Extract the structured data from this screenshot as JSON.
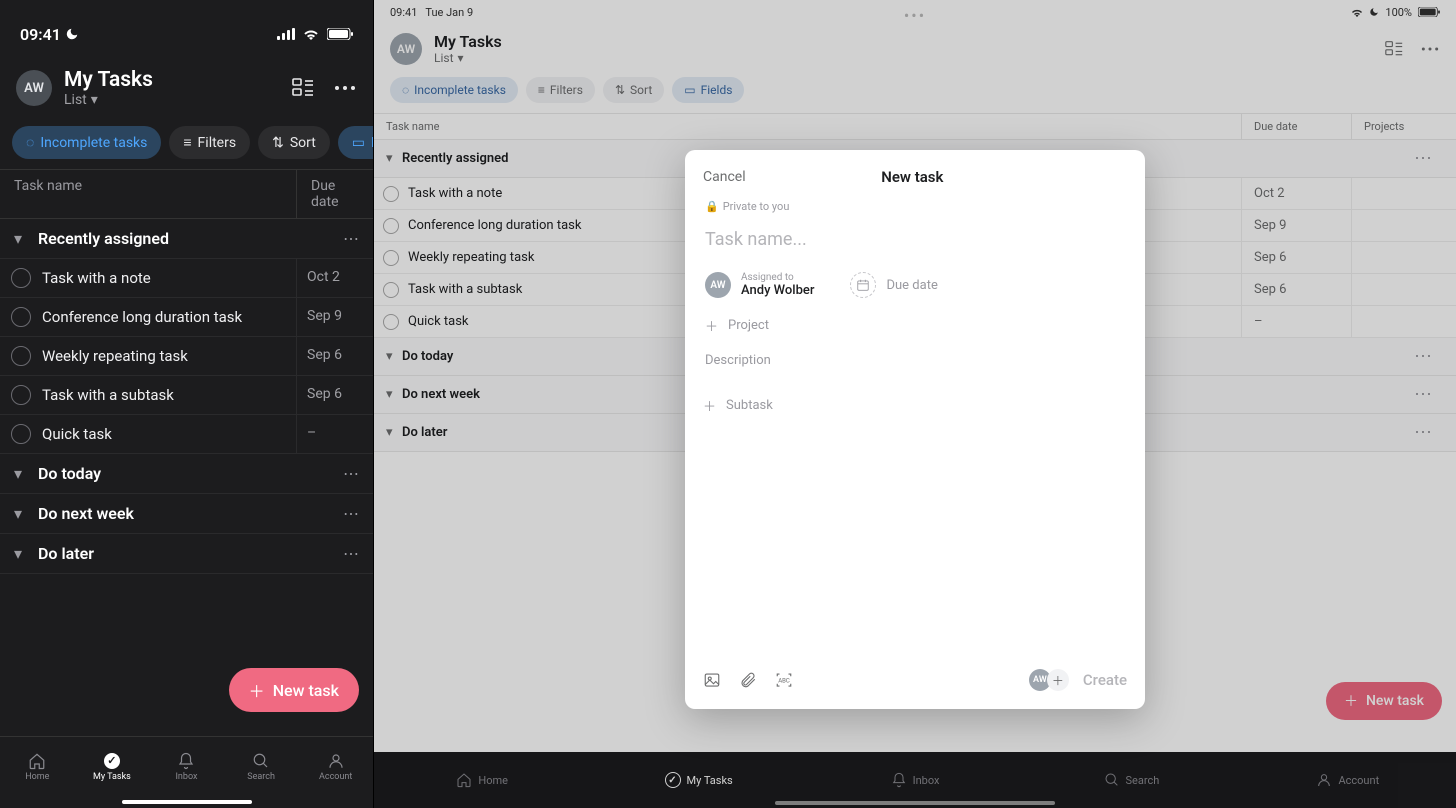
{
  "phone": {
    "status_time": "09:41",
    "avatar": "AW",
    "title": "My Tasks",
    "subtitle": "List",
    "chips": {
      "incomplete": "Incomplete tasks",
      "filters": "Filters",
      "sort": "Sort",
      "fields": "Fields"
    },
    "columns": {
      "task": "Task name",
      "due": "Due date"
    },
    "sections": [
      {
        "title": "Recently assigned",
        "rows": [
          {
            "name": "Task with a note",
            "due": "Oct 2"
          },
          {
            "name": "Conference long duration task",
            "due": "Sep 9"
          },
          {
            "name": "Weekly repeating task",
            "due": "Sep 6"
          },
          {
            "name": "Task with a subtask",
            "due": "Sep 6"
          },
          {
            "name": "Quick task",
            "due": "–"
          }
        ]
      },
      {
        "title": "Do today",
        "rows": []
      },
      {
        "title": "Do next week",
        "rows": []
      },
      {
        "title": "Do later",
        "rows": []
      }
    ],
    "fab": "New task",
    "tabs": {
      "home": "Home",
      "mytasks": "My Tasks",
      "inbox": "Inbox",
      "search": "Search",
      "account": "Account"
    }
  },
  "tablet": {
    "status_time": "09:41",
    "status_date": "Tue Jan 9",
    "battery": "100%",
    "avatar": "AW",
    "title": "My Tasks",
    "subtitle": "List",
    "chips": {
      "incomplete": "Incomplete tasks",
      "filters": "Filters",
      "sort": "Sort",
      "fields": "Fields"
    },
    "columns": {
      "task": "Task name",
      "due": "Due date",
      "projects": "Projects"
    },
    "sections": [
      {
        "title": "Recently assigned",
        "rows": [
          {
            "name": "Task with a note",
            "due": "Oct 2"
          },
          {
            "name": "Conference long duration task",
            "due": "Sep 9"
          },
          {
            "name": "Weekly repeating task",
            "due": "Sep 6"
          },
          {
            "name": "Task with a subtask",
            "due": "Sep 6"
          },
          {
            "name": "Quick task",
            "due": "–"
          }
        ]
      },
      {
        "title": "Do today",
        "rows": []
      },
      {
        "title": "Do next week",
        "rows": []
      },
      {
        "title": "Do later",
        "rows": []
      }
    ],
    "fab": "New task",
    "tabs": {
      "home": "Home",
      "mytasks": "My Tasks",
      "inbox": "Inbox",
      "search": "Search",
      "account": "Account"
    }
  },
  "modal": {
    "cancel": "Cancel",
    "title": "New task",
    "private": "Private to you",
    "name_placeholder": "Task name...",
    "assigned_label": "Assigned to",
    "assigned_value": "Andy Wolber",
    "assigned_av": "AW",
    "due_label": "Due date",
    "project_label": "Project",
    "description_label": "Description",
    "subtask_label": "Subtask",
    "create": "Create"
  }
}
